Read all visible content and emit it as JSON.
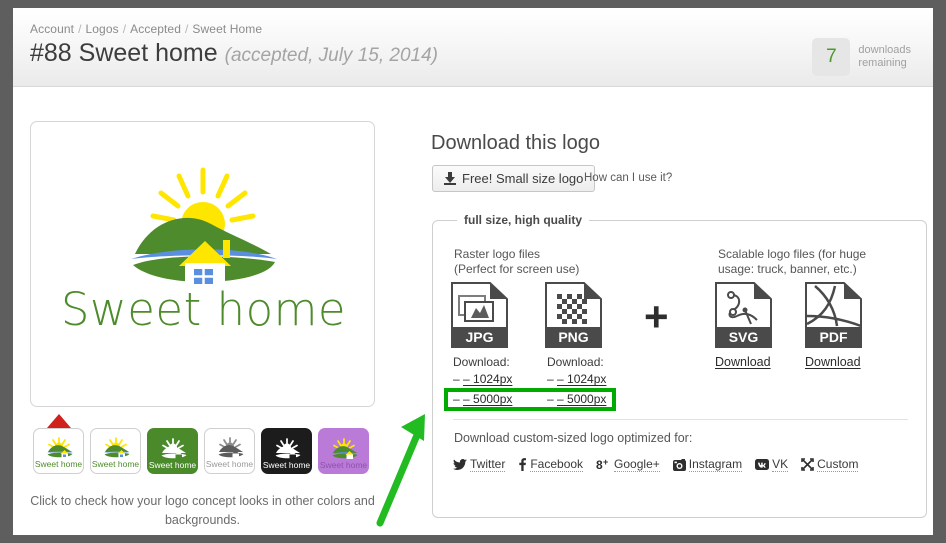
{
  "breadcrumb": {
    "items": [
      "Account",
      "Logos",
      "Accepted",
      "Sweet Home"
    ],
    "separator": "/"
  },
  "header": {
    "title": "#88 Sweet home",
    "status": "(accepted, July 15, 2014)",
    "downloads_count": "7",
    "downloads_label_line1": "downloads",
    "downloads_label_line2": "remaining",
    "count_color": "#4c9a2a"
  },
  "logo": {
    "word": "Sweet home",
    "colors": {
      "sun": "#ffe600",
      "hill": "#4e8b2c",
      "river": "#5a8fe0",
      "window": "#5a8fe0",
      "text": "#4e8b2c"
    },
    "thumbnails": [
      {
        "name": "white",
        "bg": "#ffffff",
        "text": "#4e8b2c",
        "style": "light",
        "selected": true
      },
      {
        "name": "white-2",
        "bg": "#ffffff",
        "text": "#4e8b2c",
        "style": "light",
        "selected": false
      },
      {
        "name": "green",
        "bg": "#4a8a2b",
        "text": "#ffffff",
        "style": "solid",
        "selected": false
      },
      {
        "name": "white-gray",
        "bg": "#ffffff",
        "text": "#9a9a9a",
        "style": "light",
        "selected": false
      },
      {
        "name": "black",
        "bg": "#1c1c1c",
        "text": "#ffffff",
        "style": "solid",
        "selected": false
      },
      {
        "name": "purple",
        "bg": "#b97ad8",
        "text": "#8e53ad",
        "style": "solid",
        "selected": false
      }
    ],
    "thumb_caption": "Sweet home",
    "hint": "Click to check how your logo concept looks in other colors and backgrounds."
  },
  "download": {
    "section_title": "Download this logo",
    "free_button": "Free! Small size logo",
    "free_button_icon": "download-icon",
    "how_link": "How can I use it?",
    "fieldset_legend": "full size, high quality",
    "raster_head_line1": "Raster logo files",
    "raster_head_line2": "(Perfect for screen use)",
    "vector_head_line1": "Scalable logo files (for huge",
    "vector_head_line2": "usage: truck, banner, etc.)",
    "plus": "+",
    "raster_files": [
      {
        "format": "JPG",
        "icon": "jpg-file-icon",
        "download_label": "Download:",
        "sizes": [
          "– 1024px",
          "– 5000px"
        ]
      },
      {
        "format": "PNG",
        "icon": "png-file-icon",
        "download_label": "Download:",
        "sizes": [
          "– 1024px",
          "– 5000px"
        ]
      }
    ],
    "vector_files": [
      {
        "format": "SVG",
        "icon": "svg-file-icon",
        "download_label": "Download"
      },
      {
        "format": "PDF",
        "icon": "pdf-file-icon",
        "download_label": "Download"
      }
    ],
    "highlight_color": "#00aa00",
    "custom_title": "Download custom-sized logo optimized for:",
    "social": [
      {
        "label": "Twitter",
        "icon": "twitter-icon"
      },
      {
        "label": "Facebook",
        "icon": "facebook-icon"
      },
      {
        "label": "Google+",
        "icon": "googleplus-icon"
      },
      {
        "label": "Instagram",
        "icon": "instagram-icon"
      },
      {
        "label": "VK",
        "icon": "vk-icon"
      },
      {
        "label": "Custom",
        "icon": "resize-icon"
      }
    ]
  },
  "annotation": {
    "arrow_color": "#22bb22",
    "marker_color": "#d0211c"
  }
}
